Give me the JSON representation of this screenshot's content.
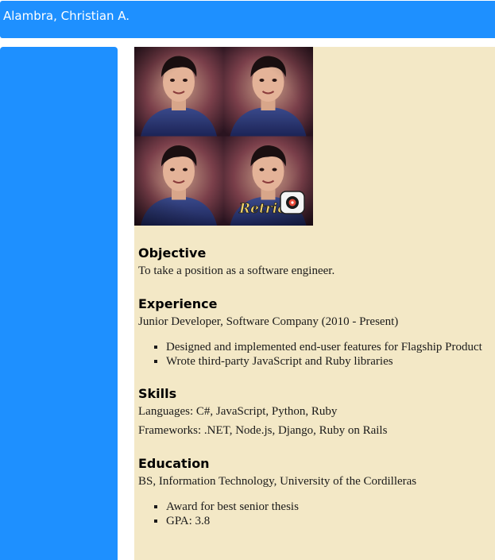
{
  "header": {
    "name": "Alambra, Christian A."
  },
  "colors": {
    "accent": "#1e90ff",
    "panel_background": "#f3e8c6"
  },
  "photo": {
    "description": "Retrica photo collage",
    "watermark_text": "Retrica"
  },
  "resume": {
    "objective": {
      "heading": "Objective",
      "text": "To take a position as a software engineer."
    },
    "experience": {
      "heading": "Experience",
      "role": "Junior Developer, Software Company (2010 - Present)",
      "items": [
        "Designed and implemented end-user features for Flagship Product",
        "Wrote third-party JavaScript and Ruby libraries"
      ]
    },
    "skills": {
      "heading": "Skills",
      "languages": "Languages: C#, JavaScript, Python, Ruby",
      "frameworks": "Frameworks: .NET, Node.js, Django, Ruby on Rails"
    },
    "education": {
      "heading": "Education",
      "degree": "BS, Information Technology, University of the Cordilleras",
      "items": [
        "Award for best senior thesis",
        "GPA: 3.8"
      ]
    }
  }
}
